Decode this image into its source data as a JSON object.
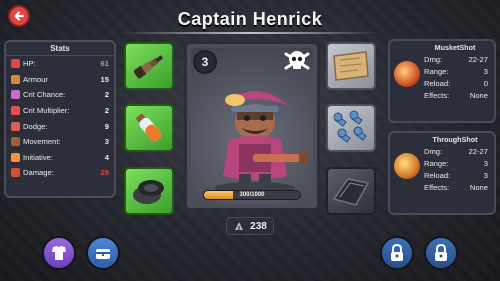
{
  "header": {
    "title": "Captain Henrick",
    "back_icon": "back-arrow-icon"
  },
  "stats": {
    "title": "Stats",
    "rows": [
      {
        "label": "HP:",
        "value": "61",
        "value_color": "#5fd35a",
        "icon": "heart-icon",
        "icon_color": "#e04848"
      },
      {
        "label": "Armour",
        "value": "15",
        "value_color": "#eaeaea",
        "icon": "shield-icon",
        "icon_color": "#d48a3a"
      },
      {
        "label": "Crit Chance:",
        "value": "2",
        "value_color": "#eaeaea",
        "icon": "crit-icon",
        "icon_color": "#c96ad0"
      },
      {
        "label": "Crit Multiplier:",
        "value": "2",
        "value_color": "#eaeaea",
        "icon": "crit-multiplier-icon",
        "icon_color": "#e94f4f"
      },
      {
        "label": "Dodge:",
        "value": "9",
        "value_color": "#eaeaea",
        "icon": "dodge-icon",
        "icon_color": "#e05a52"
      },
      {
        "label": "Movement:",
        "value": "3",
        "value_color": "#eaeaea",
        "icon": "boot-icon",
        "icon_color": "#a0603c"
      },
      {
        "label": "Initiative:",
        "value": "4",
        "value_color": "#eaeaea",
        "icon": "initiative-icon",
        "icon_color": "#ff8c36"
      },
      {
        "label": "Damage:",
        "value": "25",
        "value_color": "#e24545",
        "icon": "damage-icon",
        "icon_color": "#d44e3a"
      }
    ]
  },
  "left_slots": [
    {
      "name": "spyglass-slot",
      "icon": "spyglass-icon"
    },
    {
      "name": "potion-slot",
      "icon": "potion-icon"
    },
    {
      "name": "bandage-slot",
      "icon": "bandage-icon"
    }
  ],
  "right_slots": [
    {
      "name": "map-slot",
      "icon": "map-icon"
    },
    {
      "name": "rivets-slot",
      "icon": "rivets-icon"
    },
    {
      "name": "cloth-slot",
      "icon": "cloth-icon"
    }
  ],
  "character": {
    "level": "3",
    "faction_icon": "skull-crossbones-icon",
    "xp_text": "300/1000",
    "xp_fraction": 0.3,
    "portrait": "pirate-captain-portrait"
  },
  "currency": {
    "icon": "coin-icon",
    "amount": "238"
  },
  "weapons": [
    {
      "title": "MusketShot",
      "icon": "fire-orb-icon",
      "rows": [
        {
          "k": "Dmg:",
          "v": "22-27"
        },
        {
          "k": "Range:",
          "v": "3"
        },
        {
          "k": "Reload:",
          "v": "0"
        },
        {
          "k": "Effects:",
          "v": "None"
        }
      ]
    },
    {
      "title": "ThroughShot",
      "icon": "fire-orb-icon",
      "rows": [
        {
          "k": "Dmg:",
          "v": "22-27"
        },
        {
          "k": "Range:",
          "v": "3"
        },
        {
          "k": "Reload:",
          "v": "3"
        },
        {
          "k": "Effects:",
          "v": "None"
        }
      ]
    }
  ],
  "bottom_buttons": {
    "equip_icon": "armor-icon",
    "inventory_icon": "chest-icon",
    "lock1_icon": "lock-icon",
    "lock2_icon": "lock-icon"
  }
}
